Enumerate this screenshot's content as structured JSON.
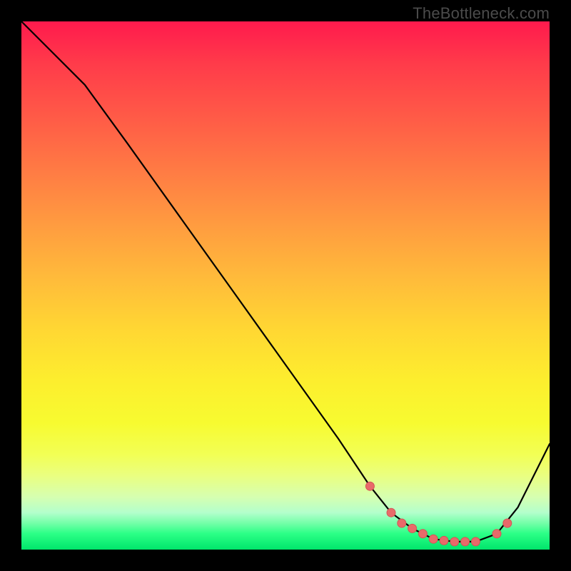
{
  "watermark": "TheBottleneck.com",
  "colors": {
    "curve": "#000000",
    "marker_fill": "#e86a6a",
    "marker_stroke": "#d45454"
  },
  "chart_data": {
    "type": "line",
    "title": "",
    "xlabel": "",
    "ylabel": "",
    "xlim": [
      0,
      100
    ],
    "ylim": [
      0,
      100
    ],
    "grid": false,
    "legend": false,
    "series": [
      {
        "name": "curve",
        "x": [
          0,
          6,
          12,
          20,
          30,
          40,
          50,
          60,
          66,
          70,
          74,
          78,
          82,
          86,
          90,
          94,
          100
        ],
        "y": [
          100,
          94,
          88,
          77,
          63,
          49,
          35,
          21,
          12,
          7,
          4,
          2,
          1.5,
          1.5,
          3,
          8,
          20
        ]
      }
    ],
    "markers": {
      "name": "highlight-points",
      "x": [
        66,
        70,
        72,
        74,
        76,
        78,
        80,
        82,
        84,
        86,
        90,
        92
      ],
      "y": [
        12,
        7,
        5,
        4,
        3,
        2,
        1.7,
        1.5,
        1.5,
        1.5,
        3,
        5
      ]
    }
  }
}
